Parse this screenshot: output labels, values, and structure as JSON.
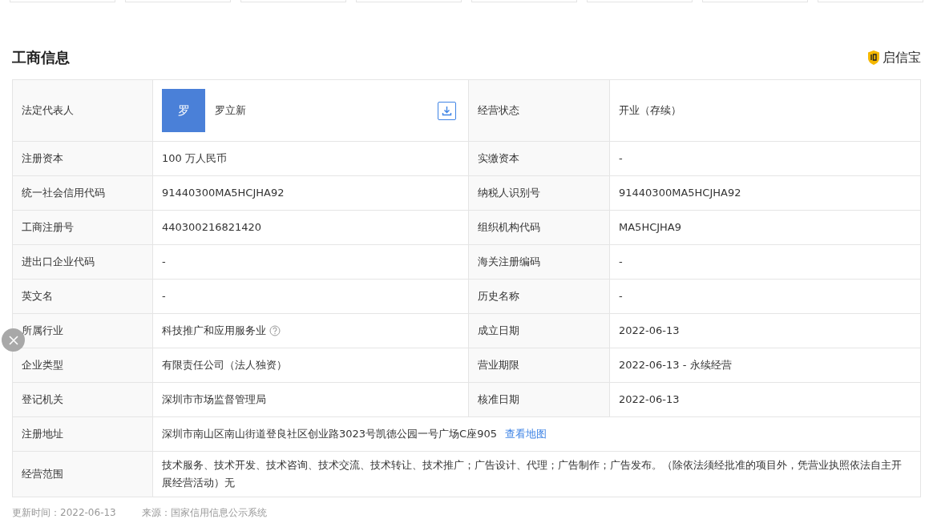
{
  "section": {
    "title": "工商信息",
    "brand": "启信宝"
  },
  "rows": [
    {
      "cells": [
        {
          "label": "法定代表人",
          "kind": "person",
          "avatar": "罗",
          "value": "罗立新"
        },
        {
          "label": "经营状态",
          "kind": "text",
          "value": "开业（存续）"
        }
      ]
    },
    {
      "cells": [
        {
          "label": "注册资本",
          "kind": "text",
          "value": "100 万人民币"
        },
        {
          "label": "实缴资本",
          "kind": "text",
          "value": "-"
        }
      ]
    },
    {
      "cells": [
        {
          "label": "统一社会信用代码",
          "kind": "text",
          "value": "91440300MA5HCJHA92"
        },
        {
          "label": "纳税人识别号",
          "kind": "text",
          "value": "91440300MA5HCJHA92"
        }
      ]
    },
    {
      "cells": [
        {
          "label": "工商注册号",
          "kind": "text",
          "value": "440300216821420"
        },
        {
          "label": "组织机构代码",
          "kind": "text",
          "value": "MA5HCJHA9"
        }
      ]
    },
    {
      "cells": [
        {
          "label": "进出口企业代码",
          "kind": "text",
          "value": "-"
        },
        {
          "label": "海关注册编码",
          "kind": "text",
          "value": "-"
        }
      ]
    },
    {
      "cells": [
        {
          "label": "英文名",
          "kind": "text",
          "value": "-"
        },
        {
          "label": "历史名称",
          "kind": "text",
          "value": "-"
        }
      ]
    },
    {
      "cells": [
        {
          "label": "所属行业",
          "kind": "help",
          "value": "科技推广和应用服务业"
        },
        {
          "label": "成立日期",
          "kind": "text",
          "value": "2022-06-13"
        }
      ]
    },
    {
      "cells": [
        {
          "label": "企业类型",
          "kind": "text",
          "value": "有限责任公司（法人独资）"
        },
        {
          "label": "营业期限",
          "kind": "text",
          "value": "2022-06-13 - 永续经营"
        }
      ]
    },
    {
      "cells": [
        {
          "label": "登记机关",
          "kind": "text",
          "value": "深圳市市场监督管理局"
        },
        {
          "label": "核准日期",
          "kind": "text",
          "value": "2022-06-13"
        }
      ]
    },
    {
      "cells": [
        {
          "label": "注册地址",
          "kind": "link",
          "value": "深圳市南山区南山街道登良社区创业路3023号凯德公园一号广场C座905",
          "link": "查看地图"
        }
      ]
    },
    {
      "cells": [
        {
          "label": "经营范围",
          "kind": "text",
          "value": "技术服务、技术开发、技术咨询、技术交流、技术转让、技术推广；广告设计、代理；广告制作；广告发布。（除依法须经批准的项目外，凭营业执照依法自主开展经营活动）无"
        }
      ]
    }
  ],
  "footer": {
    "updated": "更新时间：2022-06-13",
    "source": "来源：国家信用信息公示系统"
  }
}
